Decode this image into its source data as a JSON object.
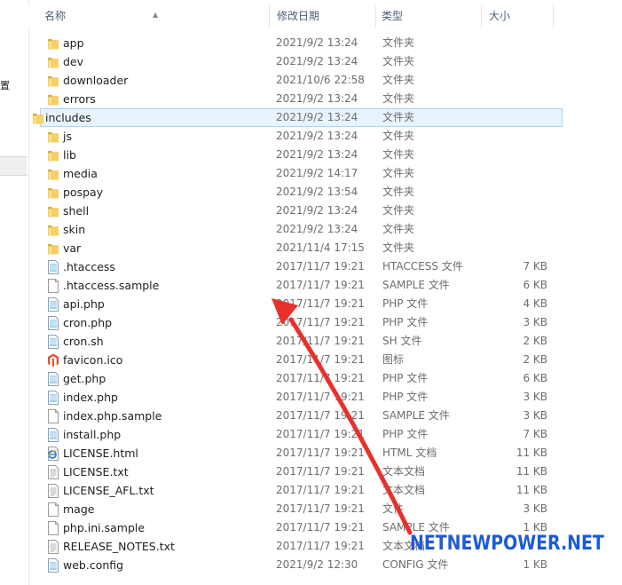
{
  "left_panel": {
    "glyph": "置"
  },
  "header": {
    "name": "名称",
    "date": "修改日期",
    "type": "类型",
    "size": "大小"
  },
  "files": [
    {
      "name": "app",
      "date": "2021/9/2 13:24",
      "type": "文件夹",
      "size": "",
      "icon": "folder-icon"
    },
    {
      "name": "dev",
      "date": "2021/9/2 13:24",
      "type": "文件夹",
      "size": "",
      "icon": "folder-icon"
    },
    {
      "name": "downloader",
      "date": "2021/10/6 22:58",
      "type": "文件夹",
      "size": "",
      "icon": "folder-icon"
    },
    {
      "name": "errors",
      "date": "2021/9/2 13:24",
      "type": "文件夹",
      "size": "",
      "icon": "folder-icon"
    },
    {
      "name": "includes",
      "date": "2021/9/2 13:24",
      "type": "文件夹",
      "size": "",
      "icon": "folder-icon",
      "selected": true
    },
    {
      "name": "js",
      "date": "2021/9/2 13:24",
      "type": "文件夹",
      "size": "",
      "icon": "folder-icon"
    },
    {
      "name": "lib",
      "date": "2021/9/2 13:24",
      "type": "文件夹",
      "size": "",
      "icon": "folder-icon"
    },
    {
      "name": "media",
      "date": "2021/9/2 14:17",
      "type": "文件夹",
      "size": "",
      "icon": "folder-icon"
    },
    {
      "name": "pospay",
      "date": "2021/9/2 13:54",
      "type": "文件夹",
      "size": "",
      "icon": "folder-icon"
    },
    {
      "name": "shell",
      "date": "2021/9/2 13:24",
      "type": "文件夹",
      "size": "",
      "icon": "folder-icon"
    },
    {
      "name": "skin",
      "date": "2021/9/2 13:24",
      "type": "文件夹",
      "size": "",
      "icon": "folder-icon"
    },
    {
      "name": "var",
      "date": "2021/11/4 17:15",
      "type": "文件夹",
      "size": "",
      "icon": "folder-icon"
    },
    {
      "name": ".htaccess",
      "date": "2017/11/7 19:21",
      "type": "HTACCESS 文件",
      "size": "7 KB",
      "icon": "config-file-icon"
    },
    {
      "name": ".htaccess.sample",
      "date": "2017/11/7 19:21",
      "type": "SAMPLE 文件",
      "size": "6 KB",
      "icon": "blank-file-icon"
    },
    {
      "name": "api.php",
      "date": "2017/11/7 19:21",
      "type": "PHP 文件",
      "size": "4 KB",
      "icon": "config-file-icon"
    },
    {
      "name": "cron.php",
      "date": "2017/11/7 19:21",
      "type": "PHP 文件",
      "size": "3 KB",
      "icon": "config-file-icon"
    },
    {
      "name": "cron.sh",
      "date": "2017/11/7 19:21",
      "type": "SH 文件",
      "size": "2 KB",
      "icon": "config-file-icon"
    },
    {
      "name": "favicon.ico",
      "date": "2017/11/7 19:21",
      "type": "图标",
      "size": "2 KB",
      "icon": "magento-logo-icon"
    },
    {
      "name": "get.php",
      "date": "2017/11/7 19:21",
      "type": "PHP 文件",
      "size": "6 KB",
      "icon": "config-file-icon"
    },
    {
      "name": "index.php",
      "date": "2017/11/7 19:21",
      "type": "PHP 文件",
      "size": "3 KB",
      "icon": "config-file-icon"
    },
    {
      "name": "index.php.sample",
      "date": "2017/11/7 19:21",
      "type": "SAMPLE 文件",
      "size": "3 KB",
      "icon": "blank-file-icon"
    },
    {
      "name": "install.php",
      "date": "2017/11/7 19:21",
      "type": "PHP 文件",
      "size": "7 KB",
      "icon": "config-file-icon"
    },
    {
      "name": "LICENSE.html",
      "date": "2017/11/7 19:21",
      "type": "HTML 文档",
      "size": "11 KB",
      "icon": "ie-html-icon"
    },
    {
      "name": "LICENSE.txt",
      "date": "2017/11/7 19:21",
      "type": "文本文档",
      "size": "11 KB",
      "icon": "text-file-icon"
    },
    {
      "name": "LICENSE_AFL.txt",
      "date": "2017/11/7 19:21",
      "type": "文本文档",
      "size": "11 KB",
      "icon": "text-file-icon"
    },
    {
      "name": "mage",
      "date": "2017/11/7 19:21",
      "type": "文件",
      "size": "3 KB",
      "icon": "blank-file-icon"
    },
    {
      "name": "php.ini.sample",
      "date": "2017/11/7 19:21",
      "type": "SAMPLE 文件",
      "size": "1 KB",
      "icon": "blank-file-icon"
    },
    {
      "name": "RELEASE_NOTES.txt",
      "date": "2017/11/7 19:21",
      "type": "文本文档",
      "size": "",
      "icon": "text-file-icon"
    },
    {
      "name": "web.config",
      "date": "2021/9/2 12:30",
      "type": "CONFIG 文件",
      "size": "1 KB",
      "icon": "config-file-icon"
    }
  ],
  "watermark": "NETNEWPOWER.NET",
  "colors": {
    "header_text": "#4c607a",
    "selected_bg": "#e8f4fd",
    "selected_border": "#a9d6f5",
    "arrow": "#e8302c",
    "watermark": "#1d5ad8",
    "folder": "#f2c55c"
  }
}
